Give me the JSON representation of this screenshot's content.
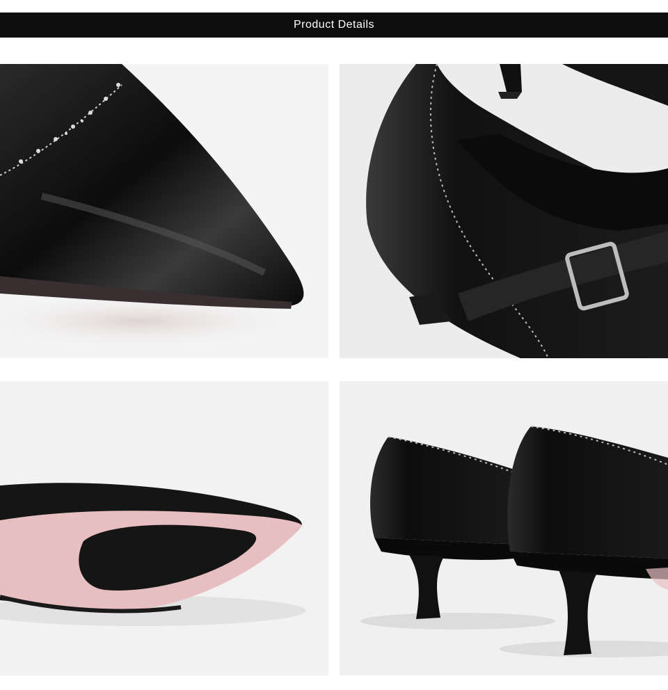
{
  "header": {
    "title": "Product Details"
  },
  "colors": {
    "header_bg": "#0e0e0e",
    "header_text": "#ffffff",
    "leather": "#141414",
    "sole_pink": "#e8bfc0"
  },
  "photos": [
    {
      "id": "toe-closeup"
    },
    {
      "id": "buckle-strap-closeup"
    },
    {
      "id": "sole-view"
    },
    {
      "id": "heel-rear-view"
    }
  ]
}
